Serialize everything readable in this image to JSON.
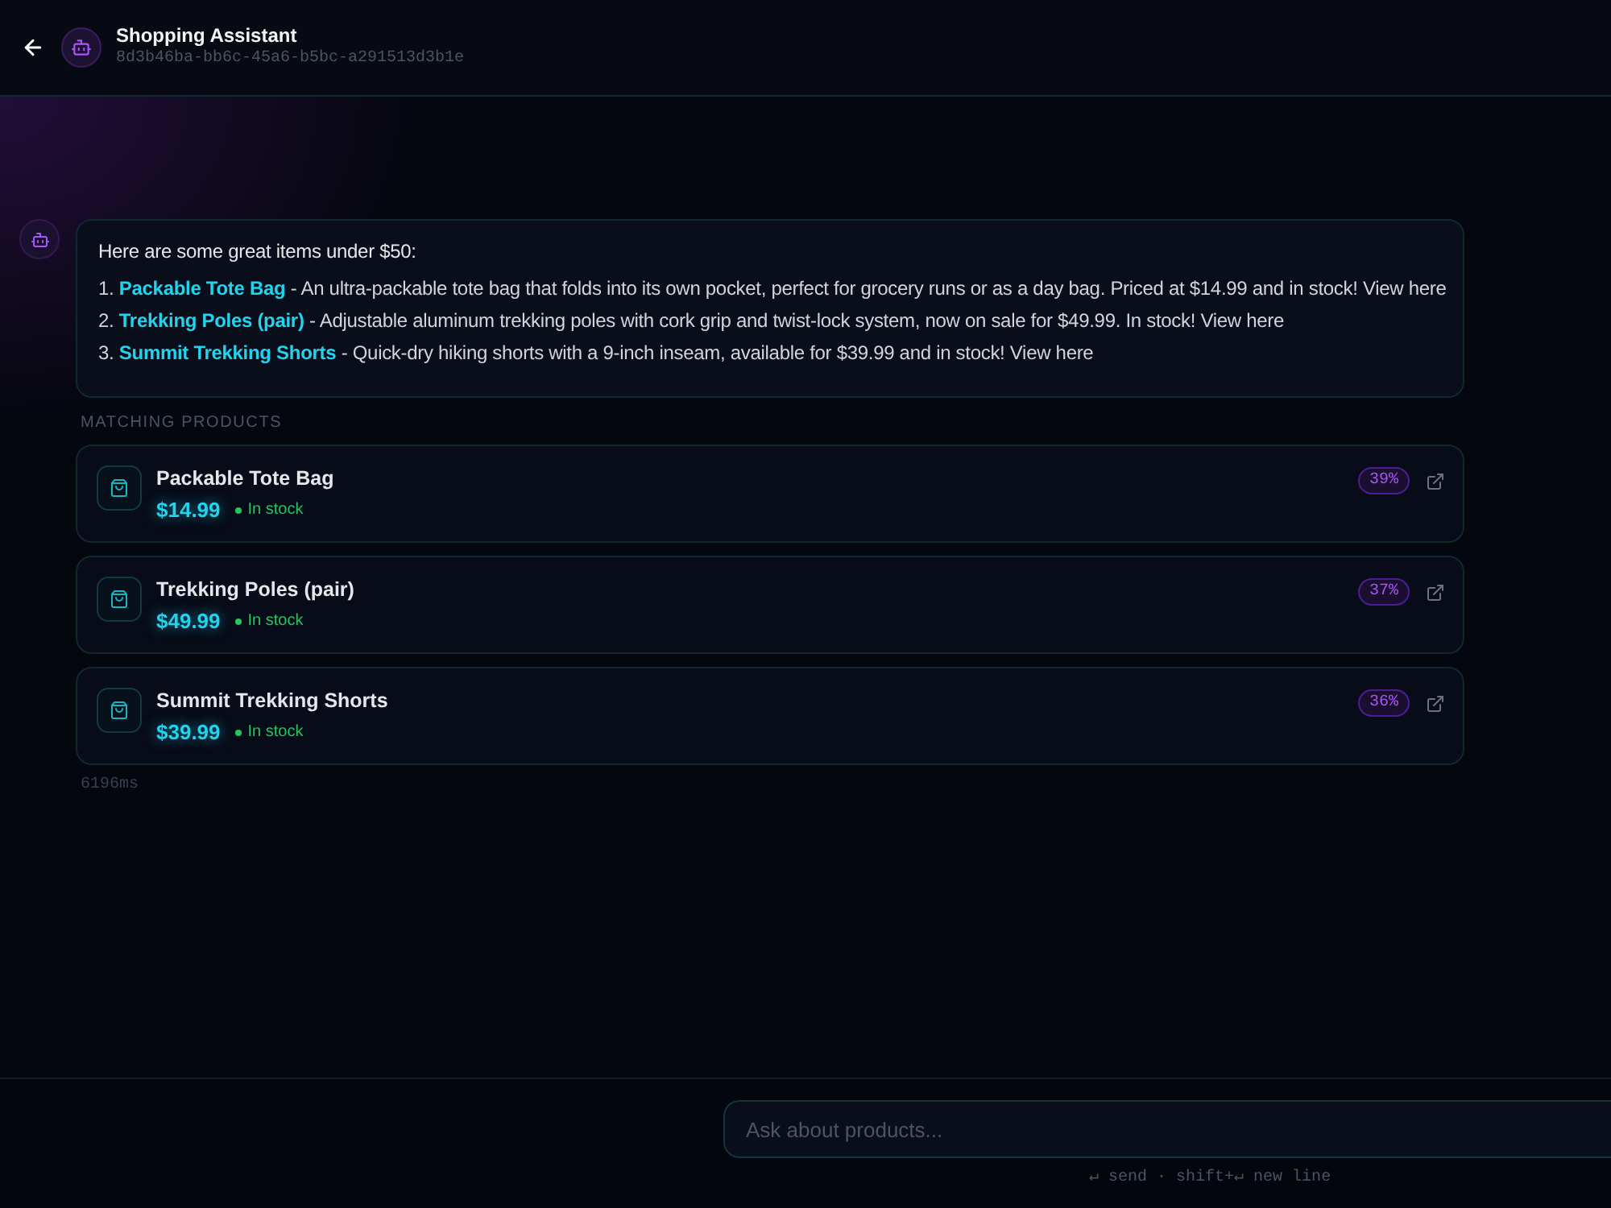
{
  "header": {
    "title": "Shopping Assistant",
    "session_id": "8d3b46ba-bb6c-45a6-b5bc-a291513d3b1e"
  },
  "message": {
    "intro": "Here are some great items under $50:",
    "items": [
      {
        "number": "1.",
        "name": "Packable Tote Bag",
        "text": "- An ultra-packable tote bag that folds into its own pocket, perfect for grocery runs or as a day bag. Priced at $14.99 and in stock! View here"
      },
      {
        "number": "2.",
        "name": "Trekking Poles (pair)",
        "text": "- Adjustable aluminum trekking poles with cork grip and twist-lock system, now on sale for $49.99. In stock! View here"
      },
      {
        "number": "3.",
        "name": "Summit Trekking Shorts",
        "text": "- Quick-dry hiking shorts with a 9-inch inseam, available for $39.99 and in stock! View here"
      }
    ]
  },
  "matching_label": "MATCHING PRODUCTS",
  "products": [
    {
      "name": "Packable Tote Bag",
      "price": "$14.99",
      "in_stock": true,
      "stock": "In stock",
      "match": "39%"
    },
    {
      "name": "Trekking Poles (pair)",
      "price": "$49.99",
      "in_stock": true,
      "stock": "In stock",
      "match": "37%"
    },
    {
      "name": "Summit Trekking Shorts",
      "price": "$39.99",
      "in_stock": true,
      "stock": "In stock",
      "match": "36%"
    }
  ],
  "latency": "6196ms",
  "composer": {
    "placeholder": "Ask about products...",
    "hint": "↵ send · shift+↵ new line"
  }
}
